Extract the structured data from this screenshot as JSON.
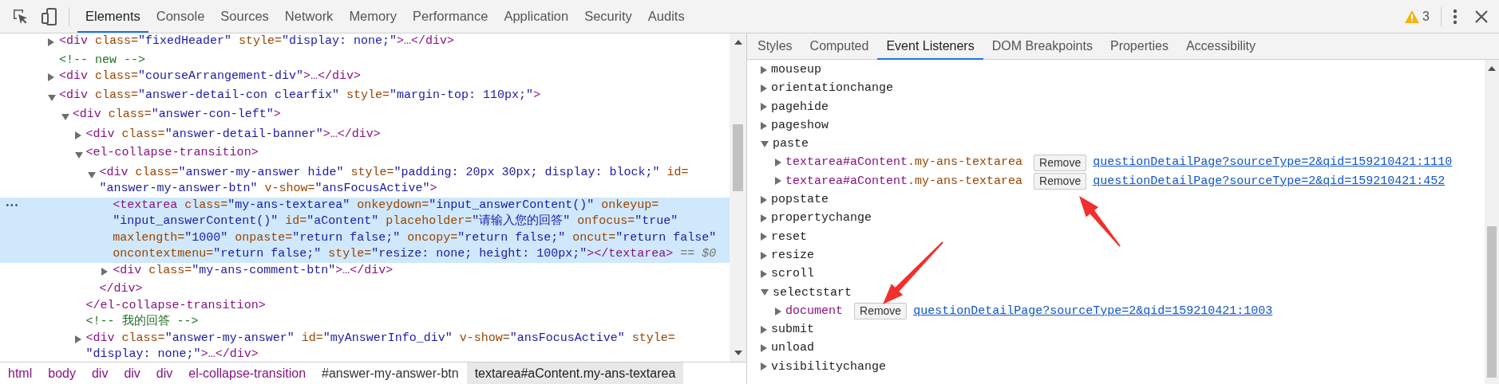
{
  "toolbar": {
    "tabs": [
      {
        "label": "Elements",
        "selected": true
      },
      {
        "label": "Console",
        "selected": false
      },
      {
        "label": "Sources",
        "selected": false
      },
      {
        "label": "Network",
        "selected": false
      },
      {
        "label": "Memory",
        "selected": false
      },
      {
        "label": "Performance",
        "selected": false
      },
      {
        "label": "Application",
        "selected": false
      },
      {
        "label": "Security",
        "selected": false
      },
      {
        "label": "Audits",
        "selected": false
      }
    ],
    "warning_count": "3"
  },
  "dom_tree": [
    {
      "kind": "toggle",
      "expanded": false,
      "selected": false,
      "lines": [
        [
          {
            "tag": "<div "
          },
          {
            "attr": "class="
          },
          {
            "value": "\"fixedHeader\""
          },
          {
            "attr": " style="
          },
          {
            "value": "\"display: none;\""
          },
          {
            "tag": ">…</div>"
          }
        ]
      ]
    },
    {
      "kind": "comment",
      "selected": false,
      "lines": [
        [
          {
            "comment": "<!-- new -->"
          }
        ]
      ]
    },
    {
      "kind": "toggle",
      "expanded": false,
      "selected": false,
      "lines": [
        [
          {
            "tag": "<div "
          },
          {
            "attr": "class="
          },
          {
            "value": "\"courseArrangement-div\""
          },
          {
            "tag": ">…</div>"
          }
        ]
      ]
    },
    {
      "kind": "toggle",
      "expanded": true,
      "selected": false,
      "lines": [
        [
          {
            "tag": "<div "
          },
          {
            "attr": "class="
          },
          {
            "value": "\"answer-detail-con clearfix\""
          },
          {
            "attr": " style="
          },
          {
            "value": "\"margin-top: 110px;\""
          },
          {
            "tag": ">"
          }
        ]
      ],
      "children": [
        {
          "kind": "toggle",
          "expanded": true,
          "selected": false,
          "lines": [
            [
              {
                "tag": "<div "
              },
              {
                "attr": "class="
              },
              {
                "value": "\"answer-con-left\""
              },
              {
                "tag": ">"
              }
            ]
          ],
          "children": [
            {
              "kind": "toggle",
              "expanded": false,
              "selected": false,
              "lines": [
                [
                  {
                    "tag": "<div "
                  },
                  {
                    "attr": "class="
                  },
                  {
                    "value": "\"answer-detail-banner\""
                  },
                  {
                    "tag": ">…</div>"
                  }
                ]
              ]
            },
            {
              "kind": "toggle",
              "expanded": true,
              "selected": false,
              "lines": [
                [
                  {
                    "tag": "<el-collapse-transition>"
                  }
                ]
              ],
              "close": [
                {
                  "tag": "</el-collapse-transition>"
                }
              ],
              "children": [
                {
                  "kind": "toggle",
                  "expanded": true,
                  "selected": false,
                  "lines": [
                    [
                      {
                        "tag": "<div "
                      },
                      {
                        "attr": "class="
                      },
                      {
                        "value": "\"answer-my-answer hide\""
                      },
                      {
                        "attr": " style="
                      },
                      {
                        "value": "\"padding: 20px 30px; display: block;\""
                      },
                      {
                        "attr": " id="
                      }
                    ],
                    [
                      {
                        "value": "\"answer-my-answer-btn\""
                      },
                      {
                        "attr": " v-show="
                      },
                      {
                        "value": "\"ansFocusActive\""
                      },
                      {
                        "tag": ">"
                      }
                    ]
                  ],
                  "close": [
                    {
                      "tag": "</div>"
                    }
                  ],
                  "children": [
                    {
                      "kind": "leaf",
                      "selected": true,
                      "marker": "•••",
                      "lines": [
                        [
                          {
                            "tag": "<textarea "
                          },
                          {
                            "attr": "class="
                          },
                          {
                            "value": "\"my-ans-textarea\""
                          },
                          {
                            "attr": " onkeydown="
                          },
                          {
                            "value": "\"input_answerContent()\""
                          },
                          {
                            "attr": " onkeyup="
                          }
                        ],
                        [
                          {
                            "value": "\"input_answerContent()\""
                          },
                          {
                            "attr": " id="
                          },
                          {
                            "value": "\"aContent\""
                          },
                          {
                            "attr": " placeholder="
                          },
                          {
                            "value": "\"请输入您的回答\""
                          },
                          {
                            "attr": " onfocus="
                          },
                          {
                            "value": "\"true\""
                          }
                        ],
                        [
                          {
                            "attr": "maxlength="
                          },
                          {
                            "value": "\"1000\""
                          },
                          {
                            "attr": " onpaste="
                          },
                          {
                            "value": "\"return false;\""
                          },
                          {
                            "attr": " oncopy="
                          },
                          {
                            "value": "\"return false;\""
                          },
                          {
                            "attr": " oncut="
                          },
                          {
                            "value": "\"return false\""
                          }
                        ],
                        [
                          {
                            "attr": "oncontextmenu="
                          },
                          {
                            "value": "\"return false;\""
                          },
                          {
                            "attr": " style="
                          },
                          {
                            "value": "\"resize: none; height: 100px;\""
                          },
                          {
                            "tag": "></textarea>"
                          },
                          {
                            "console": " == $0"
                          }
                        ]
                      ]
                    },
                    {
                      "kind": "toggle",
                      "expanded": false,
                      "selected": false,
                      "lines": [
                        [
                          {
                            "tag": "<div "
                          },
                          {
                            "attr": "class="
                          },
                          {
                            "value": "\"my-ans-comment-btn\""
                          },
                          {
                            "tag": ">…</div>"
                          }
                        ]
                      ]
                    }
                  ]
                }
              ]
            },
            {
              "kind": "comment",
              "selected": false,
              "lines": [
                [
                  {
                    "comment": "<!-- 我的回答 -->"
                  }
                ]
              ]
            },
            {
              "kind": "toggle",
              "expanded": false,
              "selected": false,
              "lines": [
                [
                  {
                    "tag": "<div "
                  },
                  {
                    "attr": "class="
                  },
                  {
                    "value": "\"answer-my-answer\""
                  },
                  {
                    "attr": " id="
                  },
                  {
                    "value": "\"myAnswerInfo_div\""
                  },
                  {
                    "attr": " v-show="
                  },
                  {
                    "value": "\"ansFocusActive\""
                  },
                  {
                    "attr": " style="
                  }
                ],
                [
                  {
                    "value": "\"display: none;\""
                  },
                  {
                    "tag": ">…</div>"
                  }
                ]
              ]
            }
          ]
        }
      ]
    }
  ],
  "breadcrumbs": [
    {
      "label": "html",
      "kind": "tag",
      "selected": false
    },
    {
      "label": "body",
      "kind": "tag",
      "selected": false
    },
    {
      "label": "div",
      "kind": "tag",
      "selected": false
    },
    {
      "label": "div",
      "kind": "tag",
      "selected": false
    },
    {
      "label": "div",
      "kind": "tag",
      "selected": false
    },
    {
      "label": "el-collapse-transition",
      "kind": "tag",
      "selected": false
    },
    {
      "label": "#answer-my-answer-btn",
      "kind": "id",
      "selected": false
    },
    {
      "label": "textarea#aContent.my-ans-textarea",
      "kind": "tag",
      "selected": true
    }
  ],
  "sidebar_tabs": [
    {
      "label": "Styles",
      "selected": false
    },
    {
      "label": "Computed",
      "selected": false
    },
    {
      "label": "Event Listeners",
      "selected": true
    },
    {
      "label": "DOM Breakpoints",
      "selected": false
    },
    {
      "label": "Properties",
      "selected": false
    },
    {
      "label": "Accessibility",
      "selected": false
    }
  ],
  "event_listeners": [
    {
      "name": "mouseup",
      "expanded": false
    },
    {
      "name": "orientationchange",
      "expanded": false
    },
    {
      "name": "pagehide",
      "expanded": false
    },
    {
      "name": "pageshow",
      "expanded": false
    },
    {
      "name": "paste",
      "expanded": true,
      "listeners": [
        {
          "target": [
            {
              "tag": "textarea"
            },
            {
              "id": "#aContent"
            },
            {
              "cls": ".my-ans-textarea"
            }
          ],
          "expanded": false,
          "button": "Remove",
          "link": "questionDetailPage?sourceType=2&qid=159210421:1110"
        },
        {
          "target": [
            {
              "tag": "textarea"
            },
            {
              "id": "#aContent"
            },
            {
              "cls": ".my-ans-textarea"
            }
          ],
          "expanded": false,
          "button": "Remove",
          "link": "questionDetailPage?sourceType=2&qid=159210421:452"
        }
      ]
    },
    {
      "name": "popstate",
      "expanded": false
    },
    {
      "name": "propertychange",
      "expanded": false
    },
    {
      "name": "reset",
      "expanded": false
    },
    {
      "name": "resize",
      "expanded": false
    },
    {
      "name": "scroll",
      "expanded": false
    },
    {
      "name": "selectstart",
      "expanded": true,
      "listeners": [
        {
          "target": [
            {
              "tag": "document"
            }
          ],
          "expanded": false,
          "button": "Remove",
          "link": "questionDetailPage?sourceType=2&qid=159210421:1003"
        }
      ]
    },
    {
      "name": "submit",
      "expanded": false
    },
    {
      "name": "unload",
      "expanded": false
    },
    {
      "name": "visibilitychange",
      "expanded": false
    }
  ]
}
